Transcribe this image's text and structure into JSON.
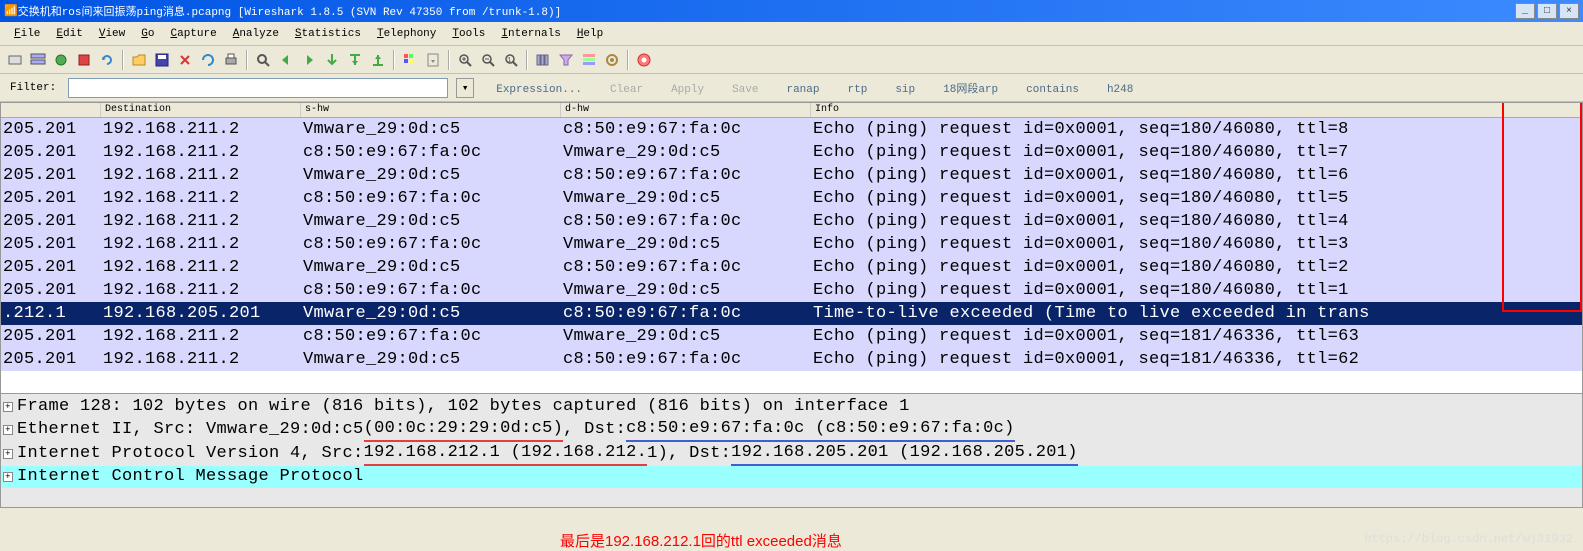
{
  "title": "交换机和ros间来回振荡ping消息.pcapng   [Wireshark 1.8.5  (SVN Rev 47350 from /trunk-1.8)]",
  "menus": [
    "File",
    "Edit",
    "View",
    "Go",
    "Capture",
    "Analyze",
    "Statistics",
    "Telephony",
    "Tools",
    "Internals",
    "Help"
  ],
  "filter": {
    "label": "Filter:",
    "value": "",
    "links": [
      "Expression...",
      "Clear",
      "Apply",
      "Save",
      "ranap",
      "rtp",
      "sip",
      "18网段arp",
      "contains",
      "h248"
    ]
  },
  "columns": {
    "dst_col": "Destination",
    "shw_col": "s-hw",
    "dhw_col": "d-hw",
    "info_col": "Info"
  },
  "packets": [
    {
      "no": "205.201",
      "dst": "192.168.211.2",
      "shw": "Vmware_29:0d:c5",
      "dhw": "c8:50:e9:67:fa:0c",
      "info": "Echo (ping) request  id=0x0001, seq=180/46080, ttl=8",
      "cls": "echo"
    },
    {
      "no": "205.201",
      "dst": "192.168.211.2",
      "shw": "c8:50:e9:67:fa:0c",
      "dhw": "Vmware_29:0d:c5",
      "info": "Echo (ping) request  id=0x0001, seq=180/46080, ttl=7",
      "cls": "echo"
    },
    {
      "no": "205.201",
      "dst": "192.168.211.2",
      "shw": "Vmware_29:0d:c5",
      "dhw": "c8:50:e9:67:fa:0c",
      "info": "Echo (ping) request  id=0x0001, seq=180/46080, ttl=6",
      "cls": "echo"
    },
    {
      "no": "205.201",
      "dst": "192.168.211.2",
      "shw": "c8:50:e9:67:fa:0c",
      "dhw": "Vmware_29:0d:c5",
      "info": "Echo (ping) request  id=0x0001, seq=180/46080, ttl=5",
      "cls": "echo"
    },
    {
      "no": "205.201",
      "dst": "192.168.211.2",
      "shw": "Vmware_29:0d:c5",
      "dhw": "c8:50:e9:67:fa:0c",
      "info": "Echo (ping) request  id=0x0001, seq=180/46080, ttl=4",
      "cls": "echo"
    },
    {
      "no": "205.201",
      "dst": "192.168.211.2",
      "shw": "c8:50:e9:67:fa:0c",
      "dhw": "Vmware_29:0d:c5",
      "info": "Echo (ping) request  id=0x0001, seq=180/46080, ttl=3",
      "cls": "echo"
    },
    {
      "no": "205.201",
      "dst": "192.168.211.2",
      "shw": "Vmware_29:0d:c5",
      "dhw": "c8:50:e9:67:fa:0c",
      "info": "Echo (ping) request  id=0x0001, seq=180/46080, ttl=2",
      "cls": "echo"
    },
    {
      "no": "205.201",
      "dst": "192.168.211.2",
      "shw": "c8:50:e9:67:fa:0c",
      "dhw": "Vmware_29:0d:c5",
      "info": "Echo (ping) request  id=0x0001, seq=180/46080, ttl=1",
      "cls": "echo"
    },
    {
      "no": ".212.1",
      "dst": "192.168.205.201",
      "shw": "Vmware_29:0d:c5",
      "dhw": "c8:50:e9:67:fa:0c",
      "info": "Time-to-live exceeded (Time to live exceeded in trans",
      "cls": "sel"
    },
    {
      "no": "205.201",
      "dst": "192.168.211.2",
      "shw": "c8:50:e9:67:fa:0c",
      "dhw": "Vmware_29:0d:c5",
      "info": "Echo (ping) request  id=0x0001, seq=181/46336, ttl=63",
      "cls": "echo"
    },
    {
      "no": "205.201",
      "dst": "192.168.211.2",
      "shw": "Vmware_29:0d:c5",
      "dhw": "c8:50:e9:67:fa:0c",
      "info": "Echo (ping) request  id=0x0001, seq=181/46336, ttl=62",
      "cls": "echo"
    }
  ],
  "details": {
    "frame": "Frame 128: 102 bytes on wire (816 bits), 102 bytes captured (816 bits) on interface 1",
    "eth_pre": "Ethernet II, Src: Vmware_29:0d:c5 ",
    "eth_src_mac": "(00:0c:29:29:0d:c5)",
    "eth_mid": ", Dst: ",
    "eth_dst": "c8:50:e9:67:fa:0c (c8:50:e9:67:fa:0c)",
    "ip_pre": "Internet Protocol Version 4, Src: ",
    "ip_src": "192.168.212.1 (192.168.212.",
    "ip_src2": "1)",
    "ip_mid": ", Dst: ",
    "ip_dst": "192.168.205.201 (192.168.205.201)",
    "icmp": "Internet Control Message Protocol"
  },
  "annotation": "最后是192.168.212.1回的ttl exceeded消息",
  "watermark": "https://blog.csdn.net/wj31932",
  "icons": {
    "logo": "📡",
    "list": "≡",
    "folders": "📁",
    "save": "💾",
    "close": "✖",
    "reload": "🔄",
    "print": "🖨",
    "find": "🔍",
    "back": "◀",
    "fwd": "▶",
    "jump": "⤒",
    "up": "⇑",
    "down": "⇓",
    "last": "⤓",
    "stop": "■",
    "zin": "🔍+",
    "zout": "🔍-",
    "z1": "1:1",
    "zfit": "⊡",
    "cols": "☰",
    "color": "🎨",
    "opts": "🧩",
    "help": "❔"
  }
}
